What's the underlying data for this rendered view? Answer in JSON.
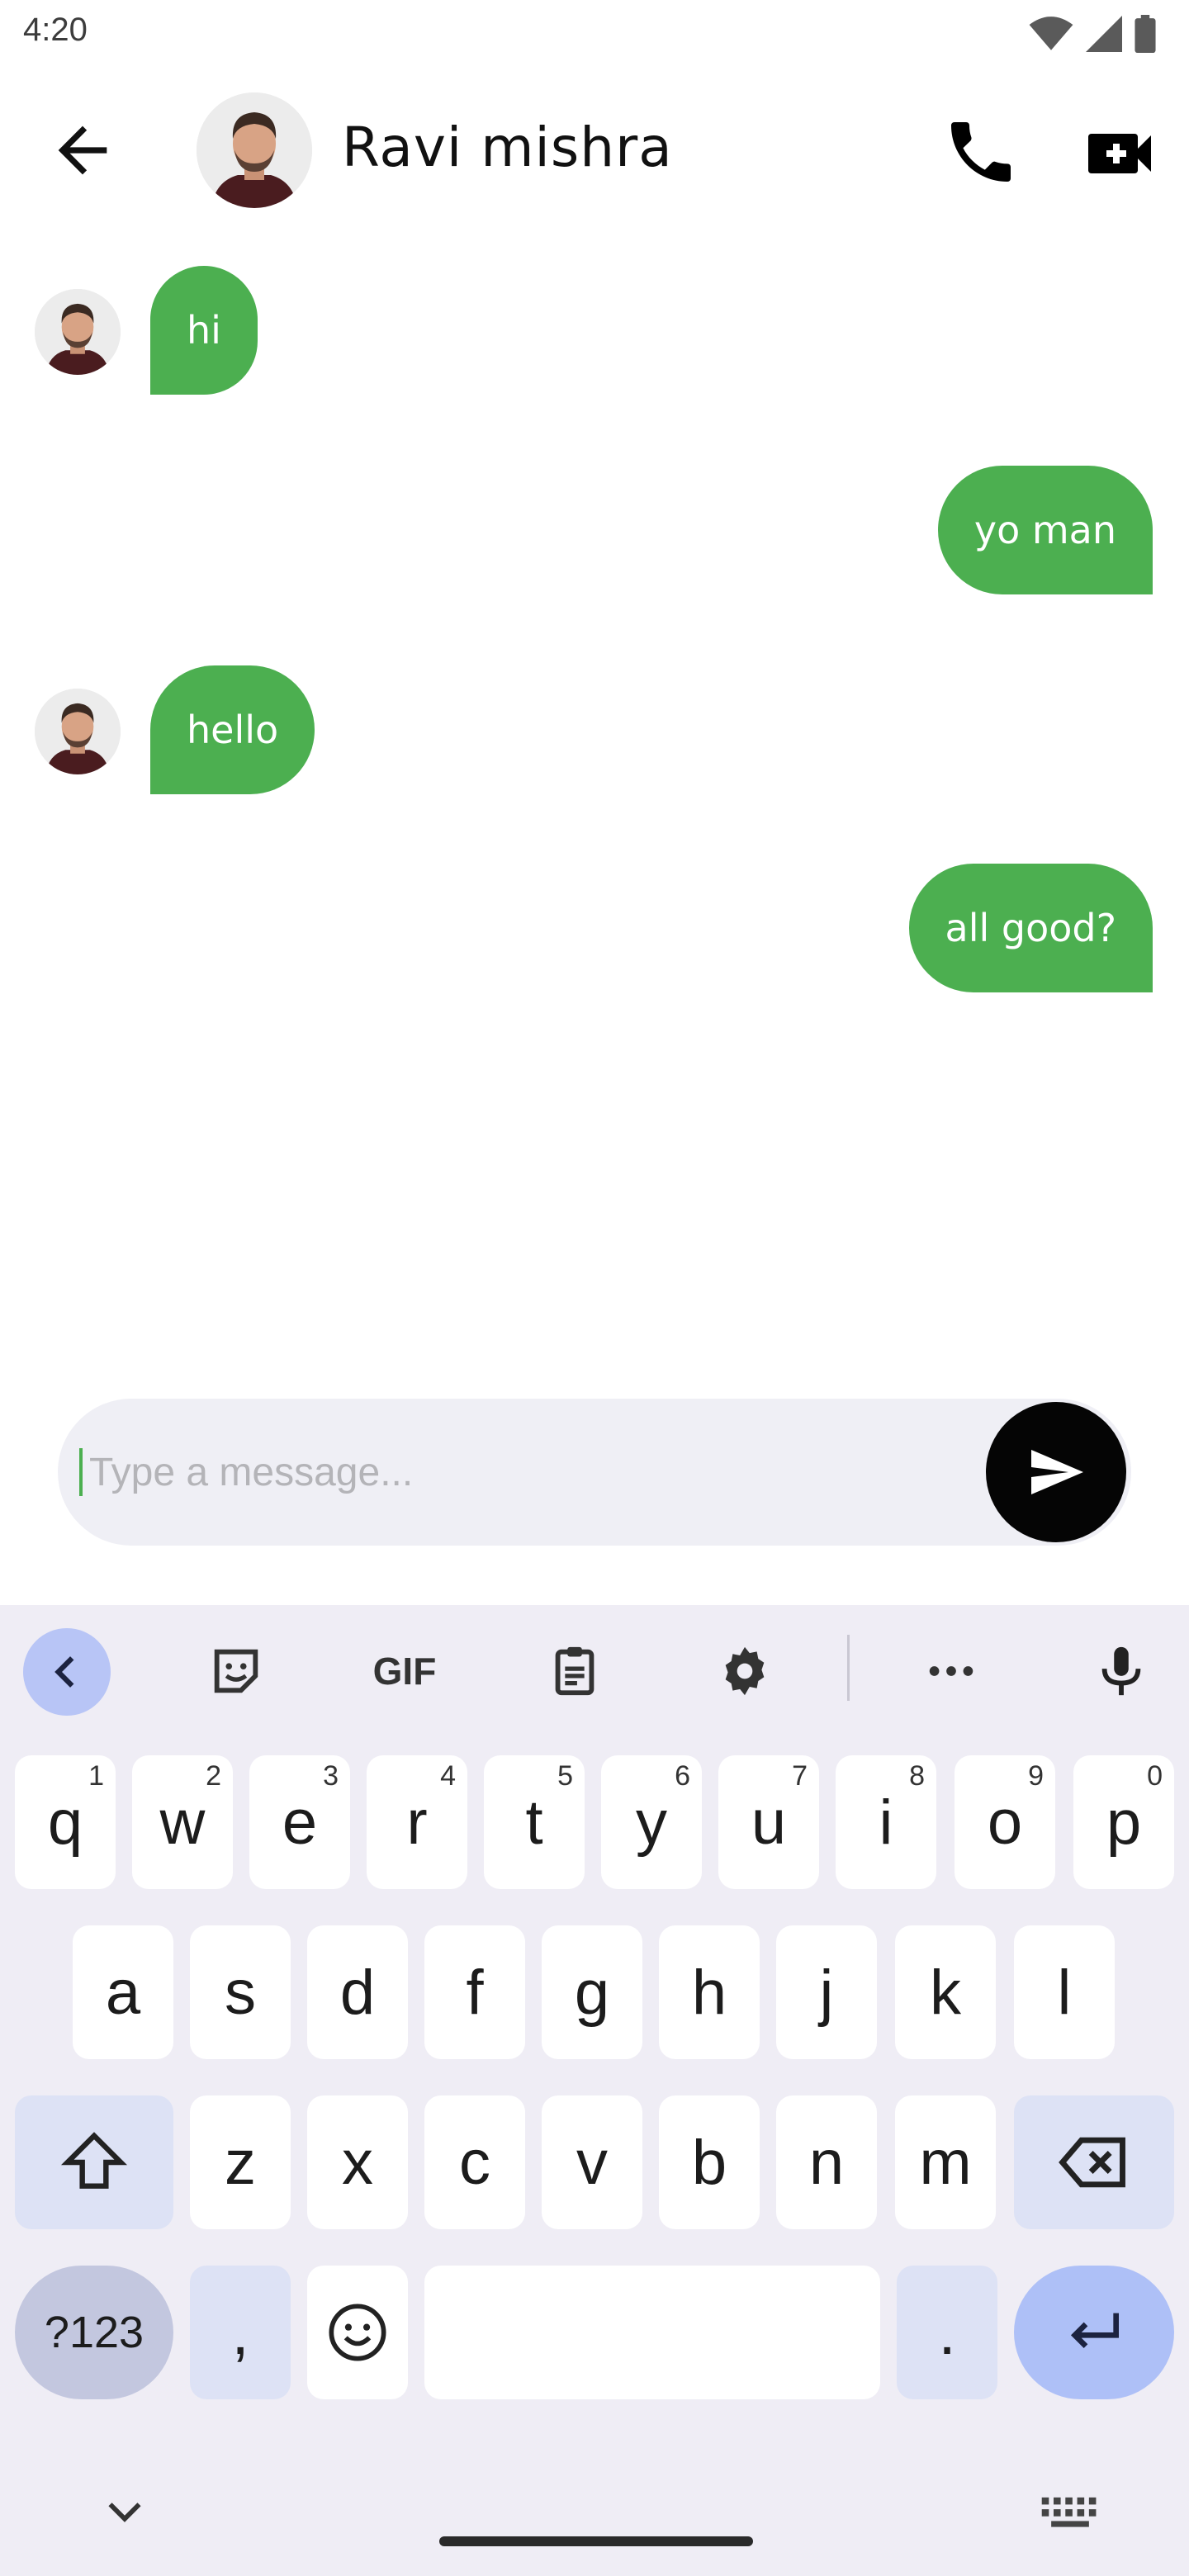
{
  "status_bar": {
    "time": "4:20",
    "icons": [
      "wifi-icon",
      "signal-icon",
      "battery-icon"
    ]
  },
  "header": {
    "contact_name": "Ravi mishra",
    "icons": [
      "back-arrow-icon",
      "phone-icon",
      "video-camera-icon"
    ]
  },
  "messages": [
    {
      "direction": "incoming",
      "text": "hi"
    },
    {
      "direction": "outgoing",
      "text": "yo man"
    },
    {
      "direction": "incoming",
      "text": "hello"
    },
    {
      "direction": "outgoing",
      "text": "all good?"
    }
  ],
  "composer": {
    "value": "",
    "placeholder": "Type a message..."
  },
  "colors": {
    "bubble": "#4caf50",
    "send_button": "#050505",
    "keyboard_bg": "#efedf5",
    "modifier_key": "#dde2f5",
    "enter_key": "#aec0f7"
  },
  "keyboard": {
    "toolbar": [
      "collapse-icon",
      "sticker-icon",
      "GIF",
      "clipboard-icon",
      "settings-icon",
      "more-icon",
      "microphone-icon"
    ],
    "row1": [
      {
        "key": "q",
        "hint": "1"
      },
      {
        "key": "w",
        "hint": "2"
      },
      {
        "key": "e",
        "hint": "3"
      },
      {
        "key": "r",
        "hint": "4"
      },
      {
        "key": "t",
        "hint": "5"
      },
      {
        "key": "y",
        "hint": "6"
      },
      {
        "key": "u",
        "hint": "7"
      },
      {
        "key": "i",
        "hint": "8"
      },
      {
        "key": "o",
        "hint": "9"
      },
      {
        "key": "p",
        "hint": "0"
      }
    ],
    "row2": [
      "a",
      "s",
      "d",
      "f",
      "g",
      "h",
      "j",
      "k",
      "l"
    ],
    "row3": [
      "z",
      "x",
      "c",
      "v",
      "b",
      "n",
      "m"
    ],
    "row4": {
      "symbols": "?123",
      "comma": ",",
      "period": "."
    }
  }
}
